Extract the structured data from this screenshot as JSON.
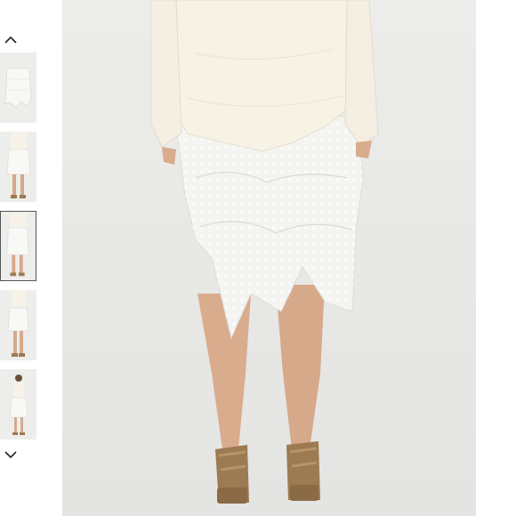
{
  "gallery": {
    "prev_icon": "chevron-up-icon",
    "next_icon": "chevron-down-icon",
    "selected_index": 3,
    "thumbnails": [
      {
        "view": "skirt-flat"
      },
      {
        "view": "model-front"
      },
      {
        "view": "model-back"
      },
      {
        "view": "model-side"
      },
      {
        "view": "model-full"
      }
    ]
  },
  "colors": {
    "backdrop": "#ececea",
    "garment": "#f7f4ec",
    "lace": "#f3f3f1",
    "skin": "#d9ac8e",
    "sandal": "#9c7a52"
  }
}
